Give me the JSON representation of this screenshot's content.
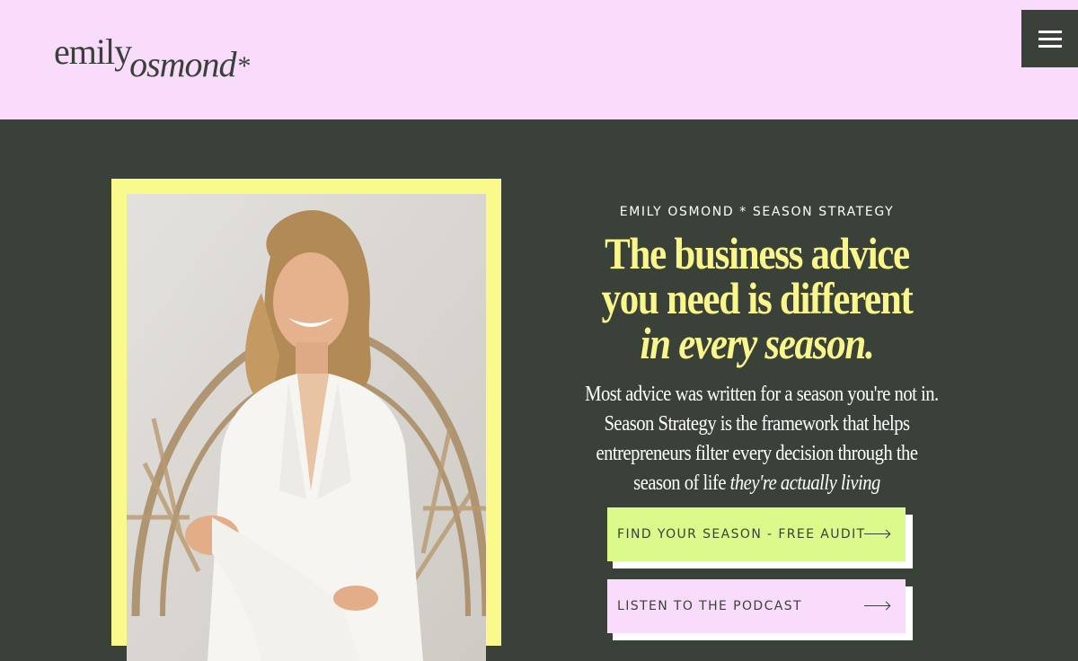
{
  "header": {
    "logo": {
      "part1": "emily",
      "part2": "osmond",
      "star": "*"
    },
    "menu_icon": "hamburger-menu-icon"
  },
  "hero": {
    "eyebrow": "EMILY OSMOND * SEASON STRATEGY",
    "headline": {
      "line1": "The business advice",
      "line2": "you need is different",
      "line3": "in every season."
    },
    "body": {
      "line1": "Most advice was written for a season you're not in.",
      "line2": "Season Strategy is the framework that helps",
      "line3": "entrepreneurs filter every decision through the",
      "line4_plain": "season of life ",
      "line4_italic": "they're actually living"
    },
    "buttons": [
      {
        "label": "FIND YOUR SEASON - FREE AUDIT",
        "color": "#dcf98c",
        "icon": "arrow-right-icon"
      },
      {
        "label": "LISTEN TO THE PODCAST",
        "color": "#f9dcfc",
        "icon": "arrow-right-icon"
      }
    ]
  },
  "colors": {
    "header_bg": "#f9dcfc",
    "hero_bg": "#3a4139",
    "frame": "#fafa8c",
    "headline": "#f9f68c"
  }
}
